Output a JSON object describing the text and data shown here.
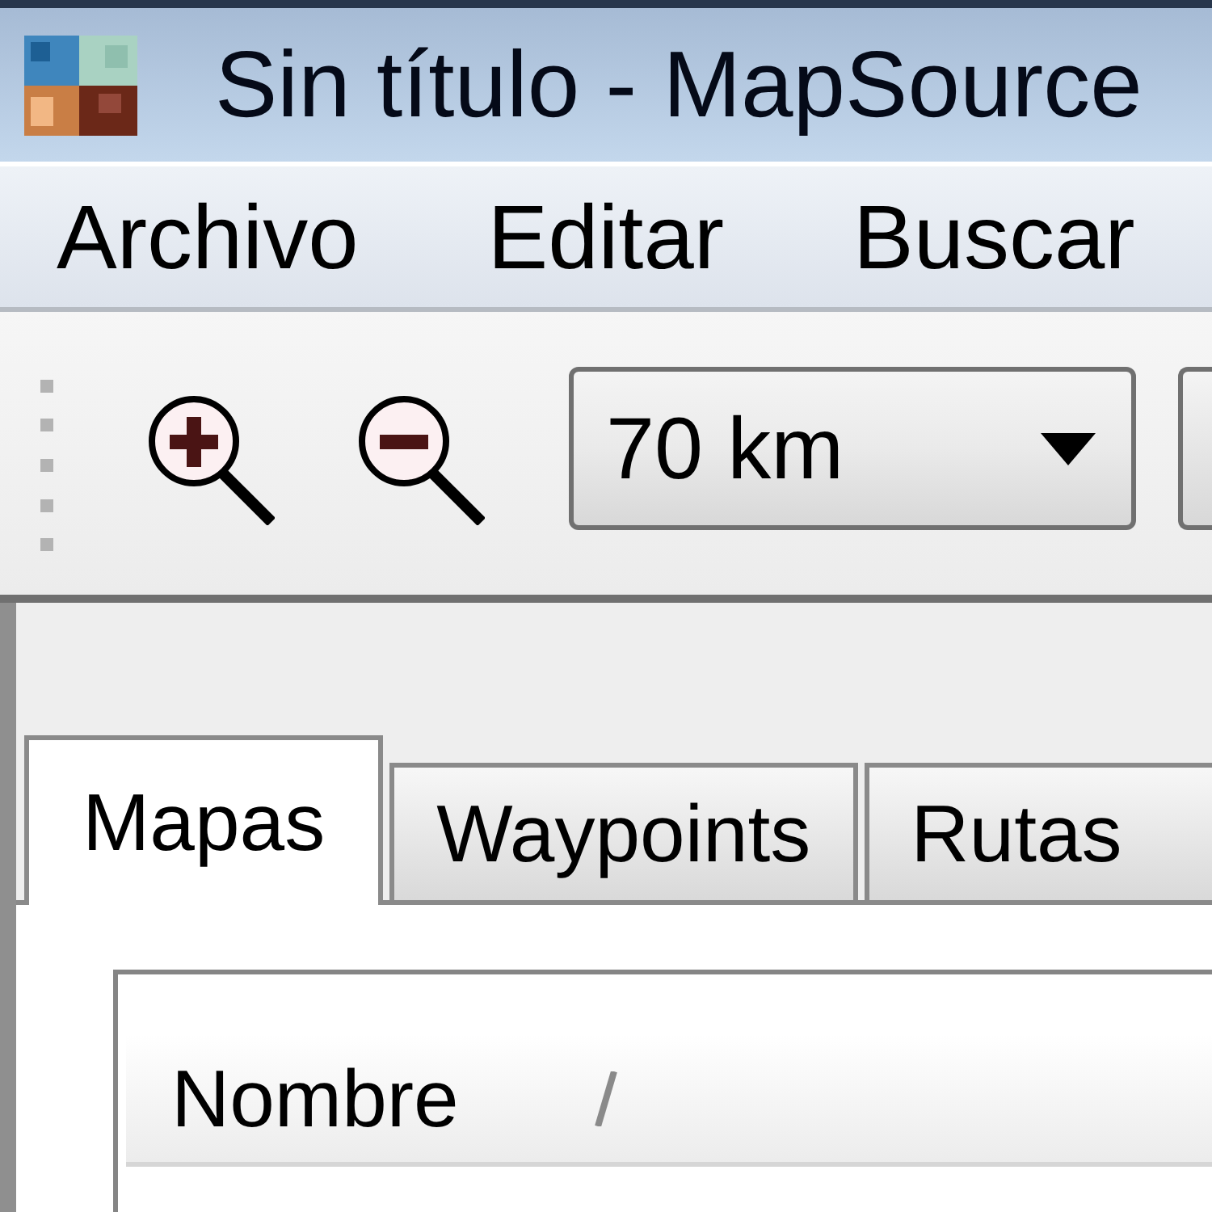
{
  "window": {
    "title": "Sin título - MapSource"
  },
  "menu": [
    "Archivo",
    "Editar",
    "Buscar"
  ],
  "toolbar": {
    "scale": "70 km"
  },
  "tabs": [
    {
      "label": "Mapas",
      "selected": true
    },
    {
      "label": "Waypoints",
      "selected": false
    },
    {
      "label": "Rutas",
      "selected": false
    }
  ],
  "list": {
    "columns": [
      "Nombre"
    ]
  }
}
